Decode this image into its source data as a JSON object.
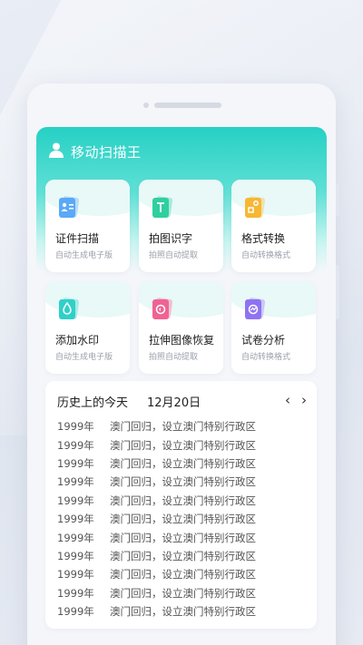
{
  "app": {
    "title": "移动扫描王"
  },
  "tools": [
    {
      "name": "证件扫描",
      "sub": "自动生成电子版",
      "icon": "id-card-icon",
      "color": "#5aa9f7"
    },
    {
      "name": "拍图识字",
      "sub": "拍照自动提取",
      "icon": "text-recognition-icon",
      "color": "#2fcf9f"
    },
    {
      "name": "格式转换",
      "sub": "自动转换格式",
      "icon": "format-convert-icon",
      "color": "#f7b733"
    },
    {
      "name": "添加水印",
      "sub": "自动生成电子版",
      "icon": "watermark-drop-icon",
      "color": "#2fd0c9"
    },
    {
      "name": "拉伸图像恢复",
      "sub": "拍照自动提取",
      "icon": "image-restore-icon",
      "color": "#f06292"
    },
    {
      "name": "试卷分析",
      "sub": "自动转换格式",
      "icon": "exam-analysis-icon",
      "color": "#8f72f2"
    }
  ],
  "history": {
    "title": "历史上的今天",
    "date": "12月20日",
    "prev_label": "‹",
    "next_label": "›",
    "events": [
      {
        "year": "1999年",
        "text": "澳门回归，设立澳门特别行政区"
      },
      {
        "year": "1999年",
        "text": "澳门回归，设立澳门特别行政区"
      },
      {
        "year": "1999年",
        "text": "澳门回归，设立澳门特别行政区"
      },
      {
        "year": "1999年",
        "text": "澳门回归，设立澳门特别行政区"
      },
      {
        "year": "1999年",
        "text": "澳门回归，设立澳门特别行政区"
      },
      {
        "year": "1999年",
        "text": "澳门回归，设立澳门特别行政区"
      },
      {
        "year": "1999年",
        "text": "澳门回归，设立澳门特别行政区"
      },
      {
        "year": "1999年",
        "text": "澳门回归，设立澳门特别行政区"
      },
      {
        "year": "1999年",
        "text": "澳门回归，设立澳门特别行政区"
      },
      {
        "year": "1999年",
        "text": "澳门回归，设立澳门特别行政区"
      },
      {
        "year": "1999年",
        "text": "澳门回归，设立澳门特别行政区"
      }
    ]
  },
  "colors": {
    "accent": "#26d0c4",
    "card": "#ffffff",
    "background": "#f5f6fa"
  }
}
